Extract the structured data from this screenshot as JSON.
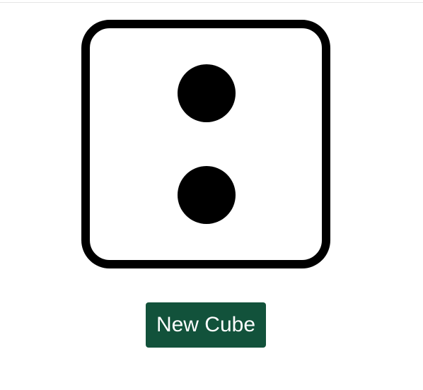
{
  "die": {
    "face_value": 2,
    "icon": "die-face-two-icon"
  },
  "controls": {
    "new_cube_label": "New Cube"
  },
  "colors": {
    "button_bg": "#12523b",
    "button_text": "#ffffff",
    "die_stroke": "#000000",
    "pip": "#000000"
  }
}
